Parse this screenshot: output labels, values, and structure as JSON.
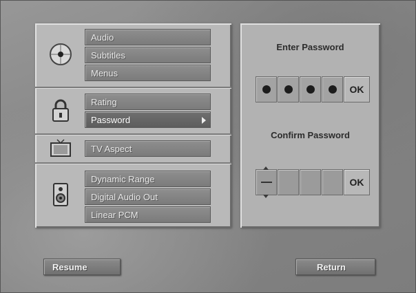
{
  "menu": {
    "groups": [
      {
        "icon": "disc-icon",
        "items": [
          {
            "label": "Audio"
          },
          {
            "label": "Subtitles"
          },
          {
            "label": "Menus"
          }
        ]
      },
      {
        "icon": "lock-icon",
        "items": [
          {
            "label": "Rating"
          },
          {
            "label": "Password"
          }
        ]
      },
      {
        "icon": "tv-icon",
        "items": [
          {
            "label": "TV Aspect"
          }
        ]
      },
      {
        "icon": "speaker-icon",
        "items": [
          {
            "label": "Dynamic Range"
          },
          {
            "label": "Digital Audio Out"
          },
          {
            "label": "Linear PCM"
          }
        ]
      }
    ],
    "selected": "Password"
  },
  "password_panel": {
    "enter_title": "Enter Password",
    "enter_ok": "OK",
    "enter_digits_filled": 4,
    "confirm_title": "Confirm Password",
    "confirm_ok": "OK",
    "confirm_digits_filled": 0
  },
  "buttons": {
    "resume": "Resume",
    "return": "Return"
  }
}
